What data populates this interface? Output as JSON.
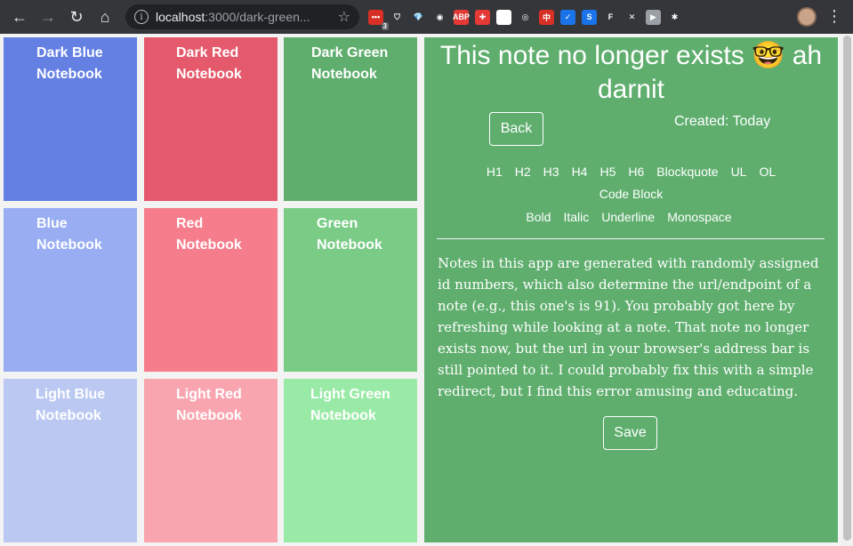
{
  "browser": {
    "url_host": "localhost",
    "url_rest": ":3000/dark-green...",
    "extension_badge": "3",
    "extensions": [
      {
        "name": "menu-ext-icon",
        "color": "#d93025",
        "glyph": "•••"
      },
      {
        "name": "pocket-icon",
        "color": "#35363a",
        "glyph": "⛉"
      },
      {
        "name": "gem-icon",
        "color": "#35363a",
        "glyph": "💎"
      },
      {
        "name": "owl-icon",
        "color": "#35363a",
        "glyph": "◉"
      },
      {
        "name": "adblock-icon",
        "color": "#e53935",
        "glyph": "ABP"
      },
      {
        "name": "puzzle-red-icon",
        "color": "#e53935",
        "glyph": "✚"
      },
      {
        "name": "eye-icon",
        "color": "#ffffff",
        "glyph": "◎"
      },
      {
        "name": "target-icon",
        "color": "#35363a",
        "glyph": "◎"
      },
      {
        "name": "chinese-icon",
        "color": "#d93025",
        "glyph": "中"
      },
      {
        "name": "check-icon",
        "color": "#1a73e8",
        "glyph": "✓"
      },
      {
        "name": "s-icon",
        "color": "#1a73e8",
        "glyph": "S"
      },
      {
        "name": "f-icon",
        "color": "#35363a",
        "glyph": "F"
      },
      {
        "name": "close-ext-icon",
        "color": "#35363a",
        "glyph": "✕"
      },
      {
        "name": "video-icon",
        "color": "#9aa0a6",
        "glyph": "▶"
      },
      {
        "name": "puzzle-icon",
        "color": "#35363a",
        "glyph": "✱"
      }
    ]
  },
  "notebooks": [
    {
      "line1": "Dark Blue",
      "line2": "Notebook",
      "color": "#6580e3"
    },
    {
      "line1": "Dark Red",
      "line2": "Notebook",
      "color": "#e45a6c"
    },
    {
      "line1": "Dark Green",
      "line2": "Notebook",
      "color": "#5fae6e"
    },
    {
      "line1": "Blue",
      "line2": "Notebook",
      "color": "#98adf2"
    },
    {
      "line1": "Red",
      "line2": "Notebook",
      "color": "#f67d8c"
    },
    {
      "line1": "Green",
      "line2": "Notebook",
      "color": "#7acb86"
    },
    {
      "line1": "Light Blue",
      "line2": "Notebook",
      "color": "#bac8f2"
    },
    {
      "line1": "Light Red",
      "line2": "Notebook",
      "color": "#f9a5b0"
    },
    {
      "line1": "Light Green",
      "line2": "Notebook",
      "color": "#9aeaa7"
    }
  ],
  "note": {
    "title": "This note no longer exists 🤓 ah darnit",
    "back_label": "Back",
    "created": "Created: Today",
    "block_tools": [
      "H1",
      "H2",
      "H3",
      "H4",
      "H5",
      "H6",
      "Blockquote",
      "UL",
      "OL",
      "Code Block"
    ],
    "inline_tools": [
      "Bold",
      "Italic",
      "Underline",
      "Monospace"
    ],
    "body": "Notes in this app are generated with randomly assigned id numbers, which also determine the url/endpoint of a note (e.g., this one's is 91). You probably got here by refreshing while looking at a note. That note no longer exists now, but the url in your browser's address bar is still pointed to it. I could probably fix this with a simple redirect, but I find this error amusing and educating.",
    "save_label": "Save",
    "panel_color": "#5fae6e"
  }
}
